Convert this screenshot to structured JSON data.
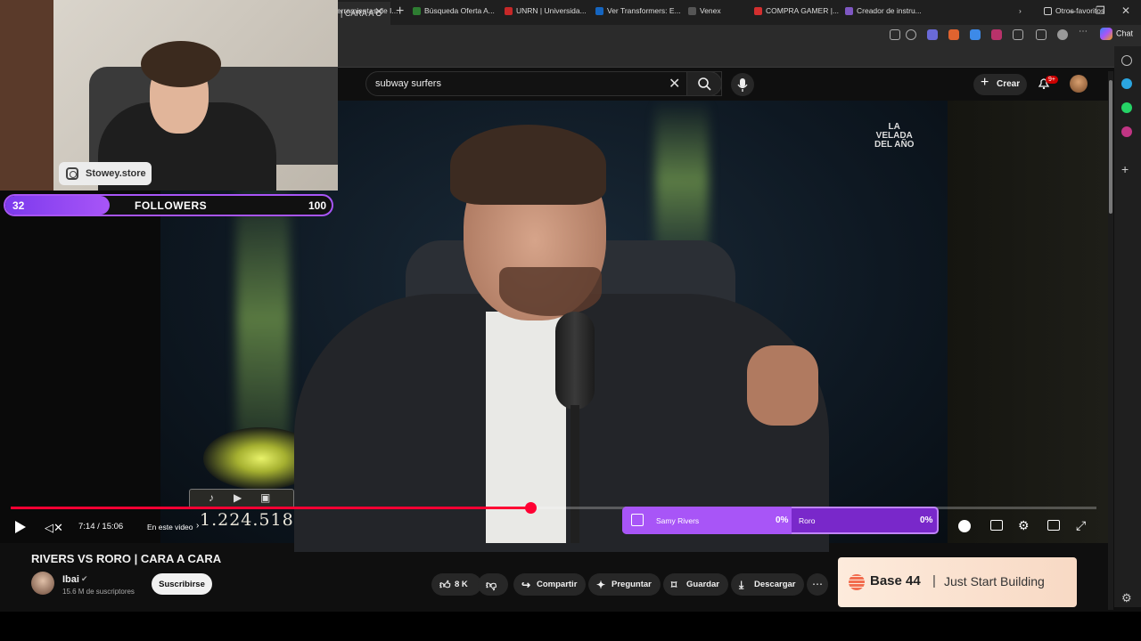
{
  "browser": {
    "tab_title": "| CARA A C",
    "new_tab": "+",
    "chat_label": "Chat",
    "bookmarks": [
      {
        "label": "erramientas de I...",
        "color": "#3c7dd9"
      },
      {
        "label": "Búsqueda Oferta A...",
        "color": "#2e7d32"
      },
      {
        "label": "UNRN | Universida...",
        "color": "#c62828"
      },
      {
        "label": "Ver Transformers: E...",
        "color": "#1565c0"
      },
      {
        "label": "Venex",
        "color": "#555555"
      },
      {
        "label": "COMPRA GAMER |...",
        "color": "#d32f2f"
      },
      {
        "label": "Creador de instru...",
        "color": "#7e57c2"
      }
    ],
    "other_favorites": "Otros favoritos"
  },
  "youtube": {
    "search_value": "subway surfers",
    "create_label": "Crear",
    "notification_count": "9+"
  },
  "overlay": {
    "instagram_handle": "Stowey.store",
    "followers_current": "32",
    "followers_label": "FOLLOWERS",
    "followers_goal": "100",
    "followers_progress": 0.32,
    "view_counter": "1.224.518",
    "velada_logo": "LA VELADA DEL AÑO"
  },
  "player": {
    "time": "7:14 / 15:06",
    "chapters_label": "En este video",
    "progress": 0.4786
  },
  "poll": {
    "option1_name": "Samy Rivers",
    "option1_pct": "0%",
    "option2_name": "Roro",
    "option2_pct": "0%"
  },
  "video": {
    "title": "RIVERS VS RORO | CARA A CARA",
    "channel": "Ibai",
    "subscribers": "15.6 M de suscriptores",
    "subscribe_label": "Suscribirse",
    "likes": "8 K",
    "share_label": "Compartir",
    "ask_label": "Preguntar",
    "save_label": "Guardar",
    "download_label": "Descargar"
  },
  "ad": {
    "brand": "Base 44",
    "separator": "|",
    "tagline": "Just Start Building"
  },
  "colors": {
    "progress": "#ff0033",
    "poll_purple": "#7928ca",
    "followers_purple": "#a855f7"
  }
}
